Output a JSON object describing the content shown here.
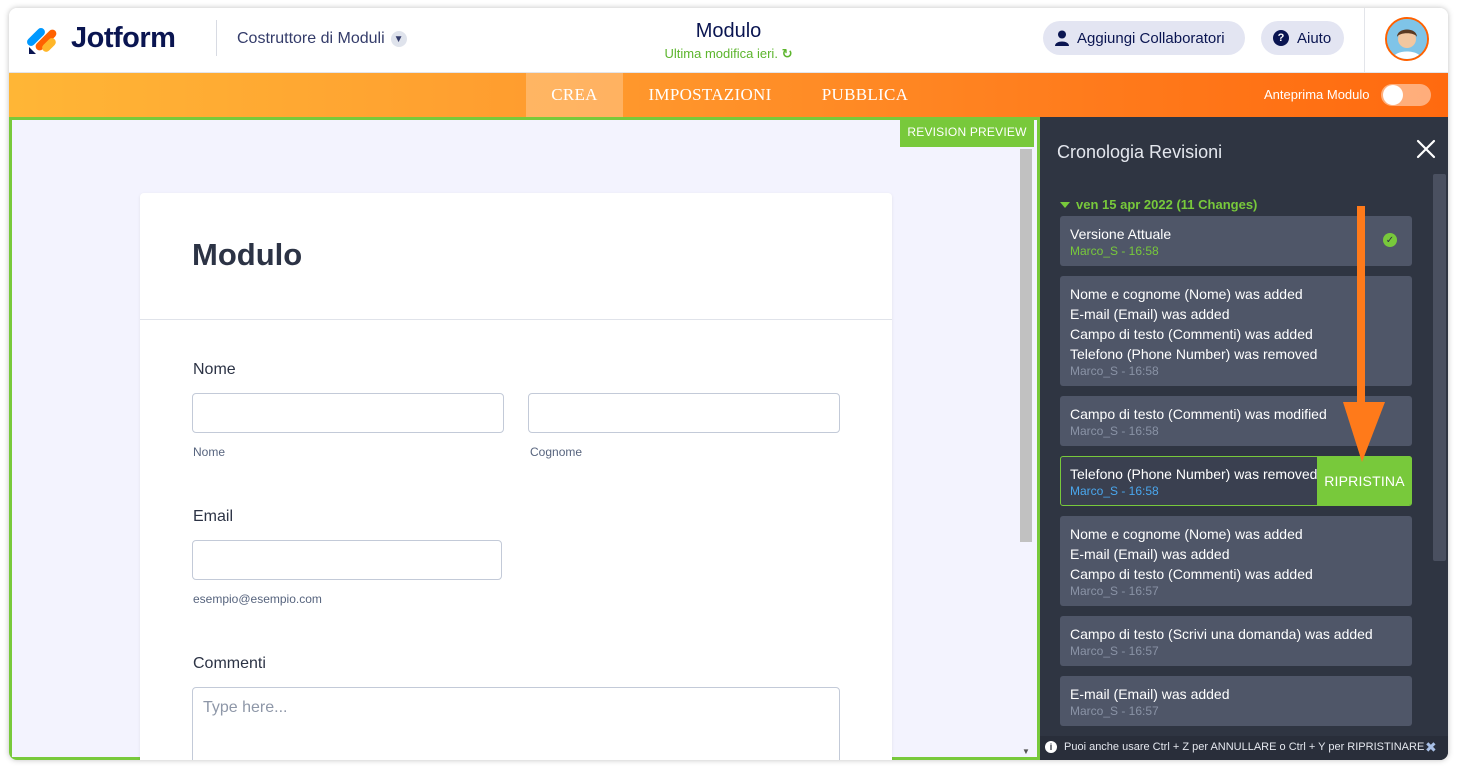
{
  "brand": {
    "name": "Jotform",
    "accent": "#ff6100",
    "green": "#78c93b"
  },
  "header": {
    "builder_label": "Costruttore di Moduli",
    "form_title": "Modulo",
    "last_modified": "Ultima modifica ieri.",
    "collaborators_label": "Aggiungi Collaboratori",
    "help_label": "Aiuto"
  },
  "nav": {
    "tabs": [
      {
        "label": "CREA",
        "active": true
      },
      {
        "label": "IMPOSTAZIONI",
        "active": false
      },
      {
        "label": "PUBBLICA",
        "active": false
      }
    ],
    "preview_label": "Anteprima Modulo",
    "preview_on": false
  },
  "canvas": {
    "badge": "REVISION PREVIEW",
    "form": {
      "title": "Modulo",
      "name_label": "Nome",
      "first_sub": "Nome",
      "last_sub": "Cognome",
      "email_label": "Email",
      "email_sub": "esempio@esempio.com",
      "comments_label": "Commenti",
      "comments_placeholder": "Type here..."
    }
  },
  "panel": {
    "title": "Cronologia Revisioni",
    "date_header": "ven 15 apr 2022 (11 Changes)",
    "restore_label": "RIPRISTINA",
    "revisions": [
      {
        "lines": [
          "Versione Attuale"
        ],
        "meta": "Marco_S - 16:58"
      },
      {
        "lines": [
          "Nome e cognome (Nome) was added",
          "E-mail (Email) was added",
          "Campo di testo (Commenti) was added",
          "Telefono (Phone Number) was removed"
        ],
        "meta": "Marco_S - 16:58"
      },
      {
        "lines": [
          "Campo di testo (Commenti) was modified"
        ],
        "meta": "Marco_S - 16:58"
      },
      {
        "lines": [
          "Telefono (Phone Number) was removed"
        ],
        "meta": "Marco_S - 16:58"
      },
      {
        "lines": [
          "Nome e cognome (Nome) was added",
          "E-mail (Email) was added",
          "Campo di testo (Commenti) was added"
        ],
        "meta": "Marco_S - 16:57"
      },
      {
        "lines": [
          "Campo di testo (Scrivi una domanda) was added"
        ],
        "meta": "Marco_S - 16:57"
      },
      {
        "lines": [
          "E-mail (Email) was added"
        ],
        "meta": "Marco_S - 16:57"
      }
    ],
    "footer_tip": "Puoi anche usare Ctrl + Z per ANNULLARE o Ctrl + Y per RIPRISTINARE"
  }
}
